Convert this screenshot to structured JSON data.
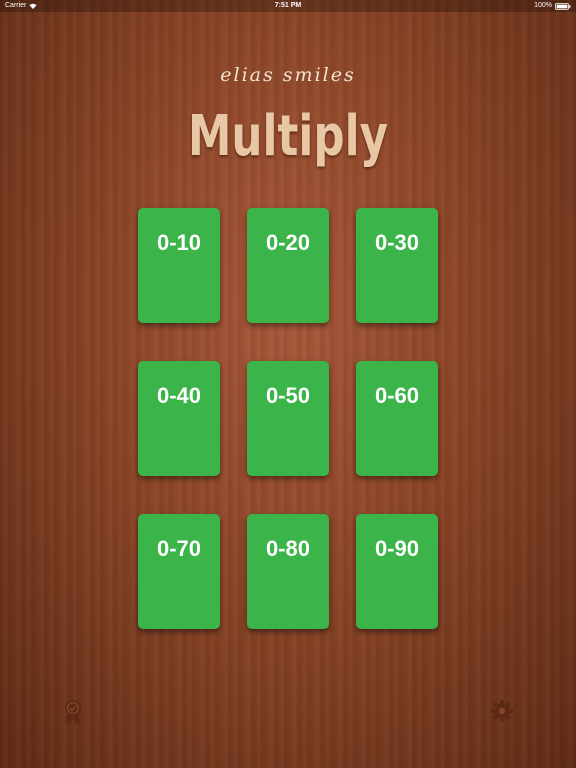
{
  "status": {
    "carrier": "Carrier",
    "time": "7:51 PM",
    "battery": "100%"
  },
  "header": {
    "brand": "elias smiles",
    "title": "Multiply"
  },
  "cards": [
    {
      "label": "0-10"
    },
    {
      "label": "0-20"
    },
    {
      "label": "0-30"
    },
    {
      "label": "0-40"
    },
    {
      "label": "0-50"
    },
    {
      "label": "0-60"
    },
    {
      "label": "0-70"
    },
    {
      "label": "0-80"
    },
    {
      "label": "0-90"
    }
  ],
  "footer": {
    "left_icon": "award-ribbon-icon",
    "right_icon": "gear-icon"
  },
  "colors": {
    "card": "#3bb44a",
    "title": "#e8c7a6",
    "icon": "#5a2a14"
  }
}
